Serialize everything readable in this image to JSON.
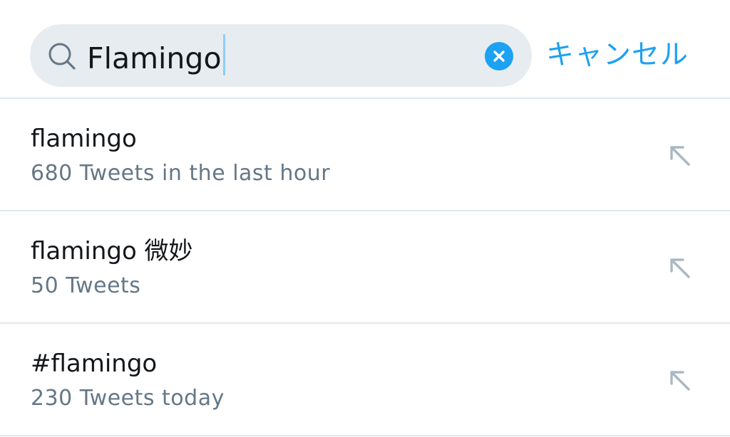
{
  "search": {
    "query": "Flamingo",
    "cancel_label": "キャンセル"
  },
  "icons": {
    "search": "search-icon",
    "clear": "clear-icon",
    "fill_query": "arrow-up-left-icon"
  },
  "colors": {
    "accent": "#1da1f2",
    "search_bg": "#e6ecf0",
    "text_primary": "#14171a",
    "text_secondary": "#657786",
    "divider": "#e1e8ed",
    "icon_muted": "#aab8c2"
  },
  "suggestions": [
    {
      "title": "flamingo",
      "subtitle": "680 Tweets in the last hour"
    },
    {
      "title": "flamingo 微妙",
      "subtitle": "50 Tweets"
    },
    {
      "title": "#flamingo",
      "subtitle": "230 Tweets today"
    }
  ]
}
